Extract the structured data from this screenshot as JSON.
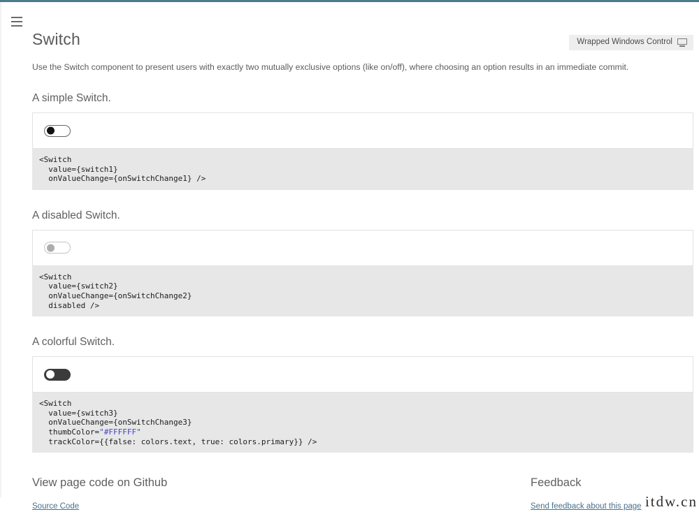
{
  "window": {
    "accent_color": "#4a7b8c",
    "menu_icon": "hamburger-icon"
  },
  "header": {
    "title": "Switch",
    "badge": {
      "label": "Wrapped Windows Control",
      "icon": "monitor-icon"
    },
    "description": "Use the Switch component to present users with exactly two mutually exclusive options (like on/off), where choosing an option results in an immediate commit."
  },
  "sections": [
    {
      "heading": "A simple Switch.",
      "switch": {
        "state": "off",
        "disabled": false,
        "thumb_color": "#121212",
        "track_color": "#FFFFFF",
        "border_color": "#666666"
      },
      "code": "<Switch\n  value={switch1}\n  onValueChange={onSwitchChange1} />"
    },
    {
      "heading": "A disabled Switch.",
      "switch": {
        "state": "off",
        "disabled": true,
        "thumb_color": "#ADADAD",
        "track_color": "#FFFFFF",
        "border_color": "#C4C4C4"
      },
      "code": "<Switch\n  value={switch2}\n  onValueChange={onSwitchChange2}\n  disabled />"
    },
    {
      "heading": "A colorful Switch.",
      "switch": {
        "state": "off",
        "disabled": false,
        "thumb_color": "#FFFFFF",
        "track_color": "#3B3B3B",
        "border_color": "#3B3B3B"
      },
      "code_lines": [
        {
          "text": "<Switch"
        },
        {
          "text": "  value={switch3}"
        },
        {
          "text": "  onValueChange={onSwitchChange3}"
        },
        {
          "text": "  thumbColor=",
          "string": "\"#FFFFFF\""
        },
        {
          "text": "  trackColor={{false: colors.text, true: colors.primary}} />"
        }
      ]
    }
  ],
  "footer": {
    "github": {
      "heading": "View page code on Github",
      "link": "Source Code"
    },
    "feedback": {
      "heading": "Feedback",
      "link": "Send feedback about this page"
    }
  },
  "watermark": "itdw.cn"
}
